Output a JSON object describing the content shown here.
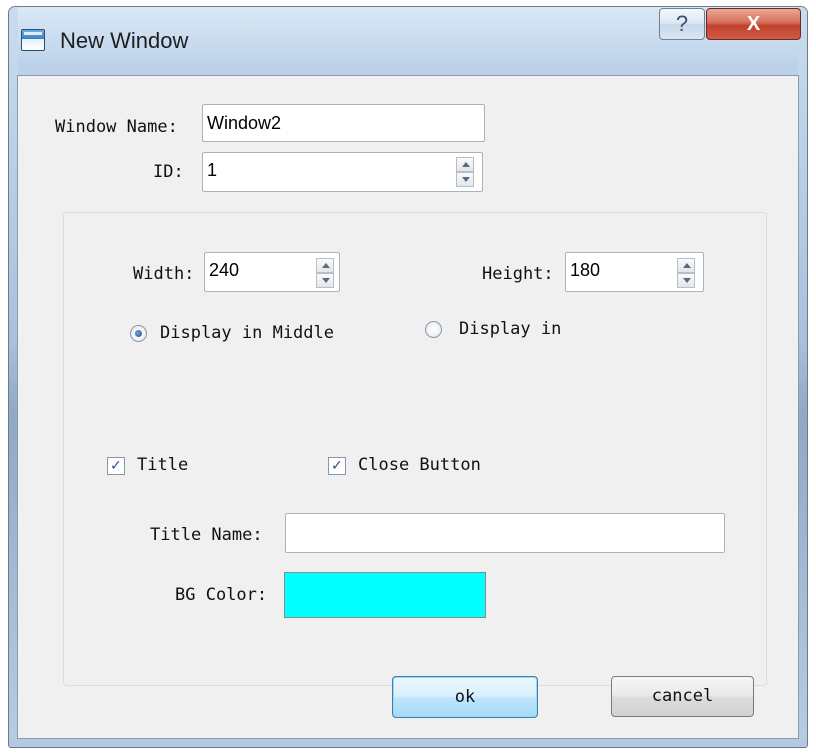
{
  "window": {
    "title": "New Window",
    "help_label": "?",
    "close_label": "X"
  },
  "form": {
    "window_name_label": "Window Name:",
    "window_name_value": "Window2",
    "id_label": "ID:",
    "id_value": "1",
    "width_label": "Width:",
    "width_value": "240",
    "height_label": "Height:",
    "height_value": "180",
    "display_middle_label": "Display in Middle",
    "display_middle_selected": true,
    "display_in_label": "Display in",
    "display_in_selected": false,
    "title_check_label": "Title",
    "title_checked": true,
    "close_button_check_label": "Close Button",
    "close_button_checked": true,
    "title_name_label": "Title Name:",
    "title_name_value": "",
    "bg_color_label": "BG Color:",
    "bg_color_value": "#00ffff"
  },
  "buttons": {
    "ok_label": "ok",
    "cancel_label": "cancel"
  },
  "icons": {
    "window_icon": "window-icon",
    "checkmark": "✓"
  },
  "colors": {
    "close_button": "#c8452f",
    "default_button_border": "#3c7fb1",
    "swatch": "#00ffff"
  }
}
